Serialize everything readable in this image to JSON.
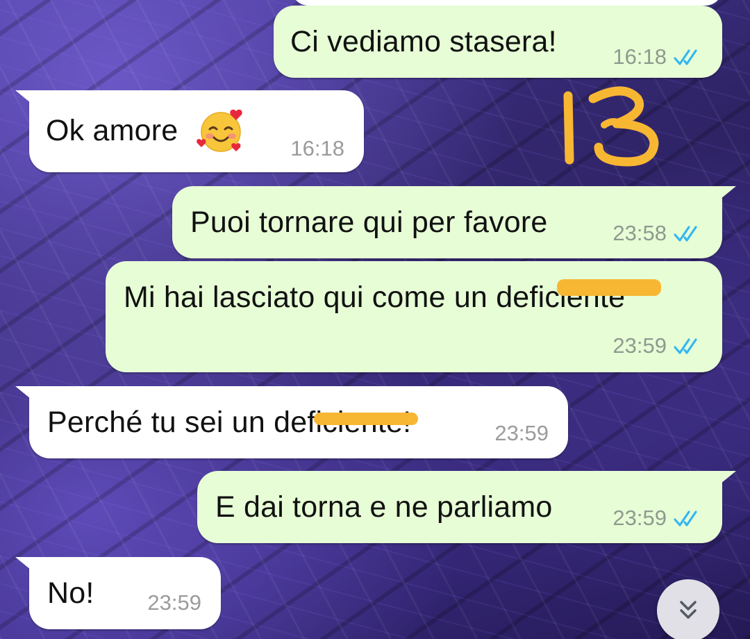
{
  "messages": [
    {
      "text": "Ci vediamo stasera!",
      "time": "16:18",
      "direction": "outgoing",
      "status": "read"
    },
    {
      "text": "Ok amore",
      "emoji": "smiling-face-with-hearts",
      "time": "16:18",
      "direction": "incoming"
    },
    {
      "text": "Puoi tornare qui per favore",
      "time": "23:58",
      "direction": "outgoing",
      "status": "read"
    },
    {
      "text": "Mi hai lasciato qui come un deficiente",
      "time": "23:59",
      "direction": "outgoing",
      "status": "read"
    },
    {
      "text": "Perché tu sei un deficiente!",
      "time": "23:59",
      "direction": "incoming"
    },
    {
      "text": "E dai torna e ne parliamo",
      "time": "23:59",
      "direction": "outgoing",
      "status": "read"
    },
    {
      "text": "No!",
      "time": "23:59",
      "direction": "incoming"
    }
  ],
  "annotation": {
    "text": "13",
    "color": "#f7b732"
  },
  "colors": {
    "outgoing_bubble": "#e7fdd6",
    "incoming_bubble": "#ffffff",
    "read_ticks": "#34b7f1",
    "redaction": "#f7b732"
  },
  "scroll_button": {
    "icon": "double-chevron-down-icon"
  }
}
